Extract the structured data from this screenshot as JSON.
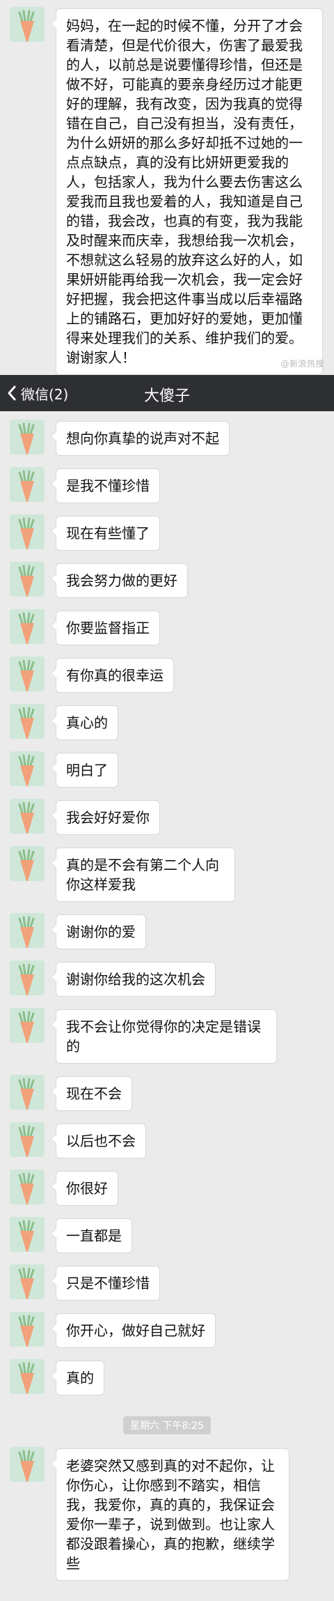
{
  "top_chat": {
    "message": "妈妈，在一起的时候不懂，分开了才会看清楚，但是代价很大，伤害了最爱我的人，以前总是说要懂得珍惜，但还是做不好，可能真的要亲身经历过才能更好的理解，我有改变，因为我真的觉得错在自己，自己没有担当，没有责任，为什么妍妍的那么多好却抵不过她的一点点缺点，真的没有比妍妍更爱我的人，包括家人，我为什么要去伤害这么爱我而且我也爱着的人，我知道是自己的错，我会改，也真的有变，我为我能及时醒来而庆幸，我想给我一次机会，不想就这么轻易的放弃这么好的人，如果妍妍能再给我一次机会，我一定会好好把握，我会把这件事当成以后幸福路上的铺路石，更加好好的爱她，更加懂得来处理我们的关系、维护我们的爱。谢谢家人！",
    "watermark": "@新浪热搜"
  },
  "nav": {
    "back_label": "微信(2)",
    "title": "大傻子"
  },
  "messages": [
    {
      "text": "想向你真挚的说声对不起"
    },
    {
      "text": "是我不懂珍惜"
    },
    {
      "text": "现在有些懂了"
    },
    {
      "text": "我会努力做的更好"
    },
    {
      "text": "你要监督指正"
    },
    {
      "text": "有你真的很幸运"
    },
    {
      "text": "真心的"
    },
    {
      "text": "明白了"
    },
    {
      "text": "我会好好爱你"
    },
    {
      "text": "真的是不会有第二个人向你这样爱我"
    },
    {
      "text": "谢谢你的爱"
    },
    {
      "text": "谢谢你给我的这次机会"
    },
    {
      "text": "我不会让你觉得你的决定是错误的"
    },
    {
      "text": "现在不会"
    },
    {
      "text": "以后也不会"
    },
    {
      "text": "你很好"
    },
    {
      "text": "一直都是"
    },
    {
      "text": "只是不懂珍惜"
    },
    {
      "text": "你开心，做好自己就好"
    },
    {
      "text": "真的"
    }
  ],
  "timestamp": "星期六 下午8:25",
  "last_message": "老婆突然又感到真的对不起你，让你伤心，让你感到不踏实，相信我，我爱你，真的真的，我保证会爱你一辈子，说到做到。也让家人都没跟着操心，真的抱歉，继续学些",
  "colors": {
    "nav_bg": "#2d2f33",
    "chat_bg": "#ebebeb",
    "bubble_bg": "#ffffff",
    "avatar_bg": "#cfe7d9",
    "avatar_carrot": "#f2a27a"
  },
  "icons": {
    "back": "chevron-left-icon",
    "avatar": "carrot-avatar-icon"
  }
}
